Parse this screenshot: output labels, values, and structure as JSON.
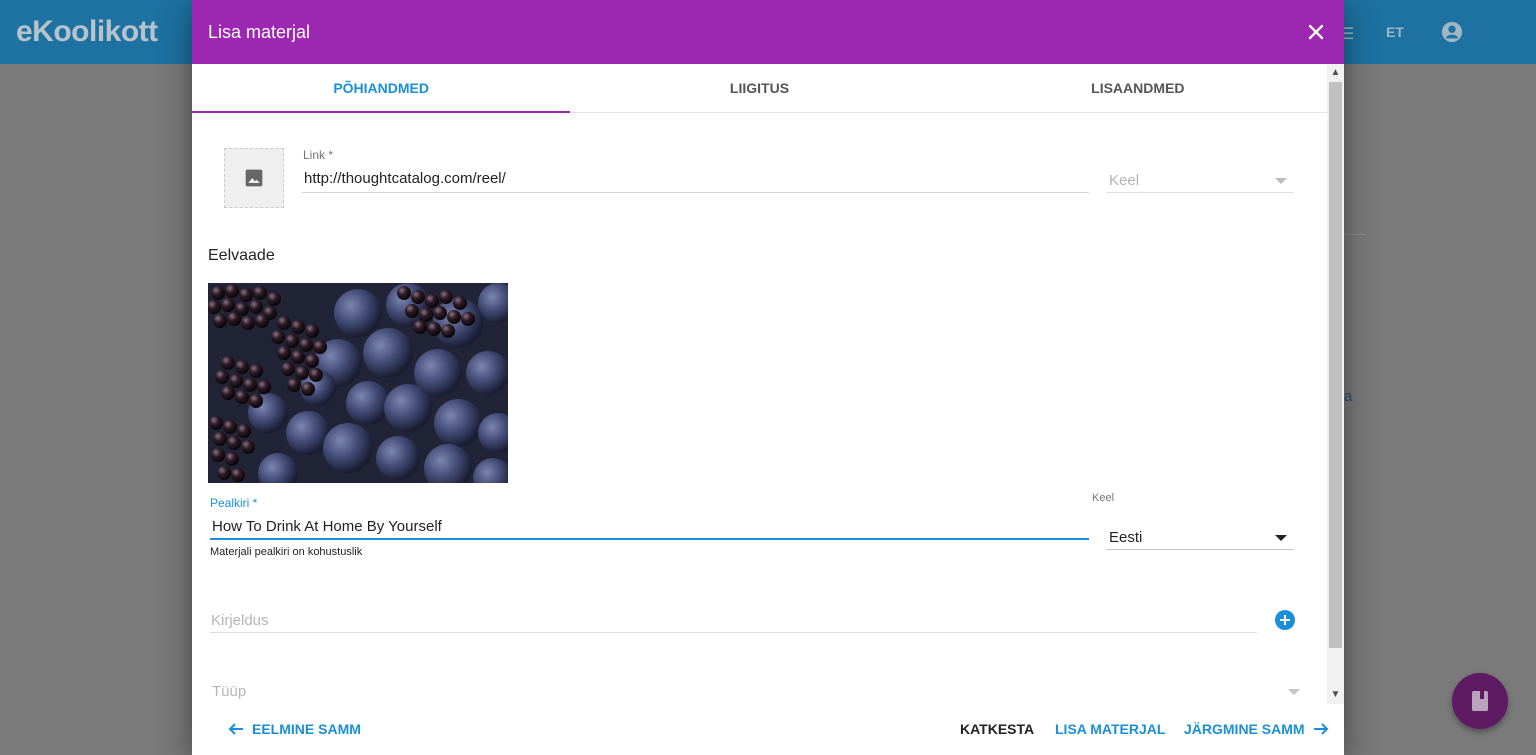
{
  "background": {
    "logo_text": "eKoolikott",
    "lang_label": "ET",
    "side_link_text": "a"
  },
  "dialog": {
    "title": "Lisa materjal",
    "tabs": [
      {
        "label": "PÕHIANDMED",
        "active": true
      },
      {
        "label": "LIIGITUS",
        "active": false
      },
      {
        "label": "LISAANDMED",
        "active": false
      }
    ],
    "link": {
      "label": "Link *",
      "value": "http://thoughtcatalog.com/reel/"
    },
    "link_language": {
      "placeholder": "Keel"
    },
    "preview_heading": "Eelvaade",
    "title_field": {
      "label": "Pealkiri *",
      "value": "How To Drink At Home By Yourself",
      "hint": "Materjali pealkiri on kohustuslik"
    },
    "title_language": {
      "label": "Keel",
      "value": "Eesti"
    },
    "description": {
      "placeholder": "Kirjeldus"
    },
    "type": {
      "placeholder": "Tüüp"
    },
    "footer": {
      "prev_label": "EELMINE SAMM",
      "cancel_label": "KATKESTA",
      "add_label": "LISA MATERJAL",
      "next_label": "JÄRGMINE SAMM"
    }
  },
  "colors": {
    "header": "#9c27b0",
    "accent": "#1a8fd8",
    "app_bar": "#1d72a2"
  }
}
